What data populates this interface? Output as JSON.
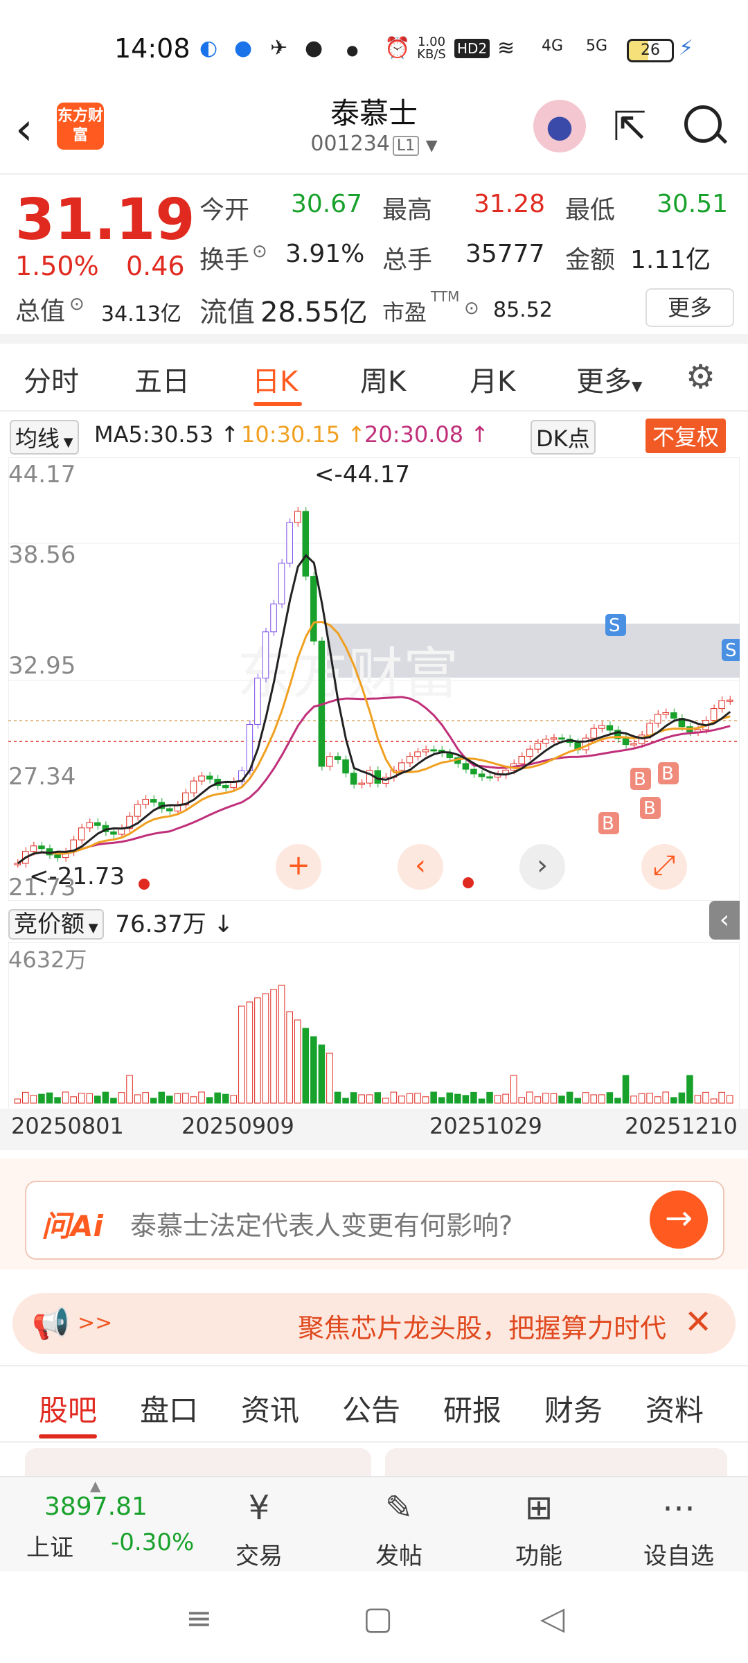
{
  "status": {
    "time": "14:08",
    "net_speed": "1.00 KB/S",
    "hd": "HD2",
    "sig1": "4G",
    "sig2": "5G",
    "battery": "26"
  },
  "header": {
    "logo": "东方财富",
    "title": "泰慕士",
    "code": "001234",
    "code_tag": "L1"
  },
  "quote": {
    "price": "31.19",
    "pct": "1.50%",
    "change": "0.46",
    "open_label": "今开",
    "open": "30.67",
    "high_label": "最高",
    "high": "31.28",
    "low_label": "最低",
    "low": "30.51",
    "turnover_label": "换手",
    "turnover": "3.91%",
    "volume_label": "总手",
    "volume": "35777",
    "amount_label": "金额",
    "amount": "1.11亿",
    "mcap_label": "总值",
    "mcap": "34.13亿",
    "float_label": "流值",
    "float": "28.55亿",
    "pe_label": "市盈",
    "pe_sup": "TTM",
    "pe": "85.52",
    "more": "更多"
  },
  "ktabs": [
    "分时",
    "五日",
    "日K",
    "周K",
    "月K",
    "更多"
  ],
  "ma": {
    "selector": "均线",
    "ma5": "MA5:30.53",
    "ma10": "10:30.15",
    "ma20": "20:30.08",
    "dk": "DK点",
    "adjust": "不复权"
  },
  "kchart": {
    "y_labels": [
      "44.17",
      "38.56",
      "32.95",
      "27.34",
      "21.73"
    ],
    "max_label": "44.17",
    "min_label": "21.73",
    "markers": [
      "S",
      "S",
      "B",
      "B",
      "B",
      "B"
    ],
    "colors": {
      "up": "#e0291f",
      "down": "#18a12b",
      "ma5": "#222222",
      "ma10": "#f0a020",
      "ma20": "#c0307a",
      "limit": "#7b4be8"
    }
  },
  "vol": {
    "selector": "竞价额",
    "value": "76.37万",
    "max_label": "4632万"
  },
  "dates": [
    "20250801",
    "20250909",
    "20251029",
    "20251210"
  ],
  "ai": {
    "logo": "问Ai",
    "question": "泰慕士法定代表人变更有何影响?"
  },
  "banner": {
    "arrows": ">>",
    "text": "聚焦芯片龙头股，把握算力时代"
  },
  "btabs": [
    "股吧",
    "盘口",
    "资讯",
    "公告",
    "研报",
    "财务",
    "资料"
  ],
  "index": {
    "value": "3897.81",
    "name": "上证",
    "pct": "-0.30%"
  },
  "toolbar": [
    "交易",
    "发帖",
    "功能",
    "设自选"
  ]
}
